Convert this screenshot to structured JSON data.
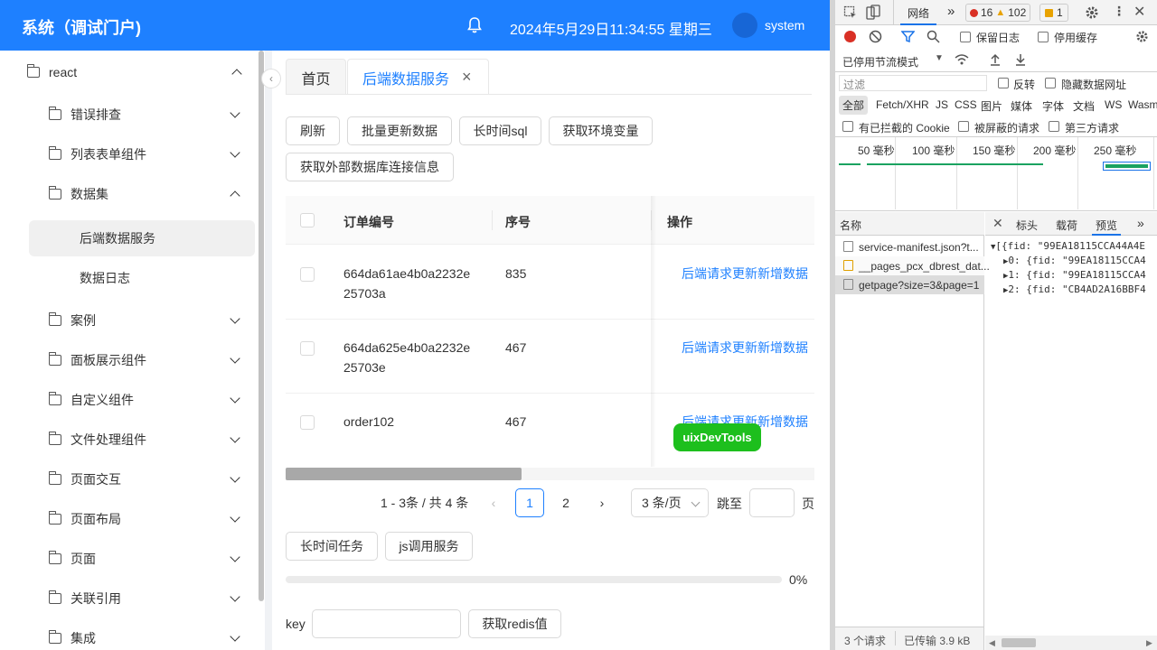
{
  "header": {
    "title": "系统（调试门户)",
    "datetime": "2024年5月29日11:34:55 星期三",
    "user": "system"
  },
  "sidebar": {
    "root": "react",
    "items": [
      {
        "label": "错误排查"
      },
      {
        "label": "列表表单组件"
      },
      {
        "label": "数据集"
      },
      {
        "label": "案例"
      },
      {
        "label": "面板展示组件"
      },
      {
        "label": "自定义组件"
      },
      {
        "label": "文件处理组件"
      },
      {
        "label": "页面交互"
      },
      {
        "label": "页面布局"
      },
      {
        "label": "页面"
      },
      {
        "label": "关联引用"
      },
      {
        "label": "集成"
      }
    ],
    "sub_items": [
      {
        "label": "后端数据服务"
      },
      {
        "label": "数据日志"
      }
    ]
  },
  "tabs": [
    {
      "label": "首页"
    },
    {
      "label": "后端数据服务",
      "close": "×"
    }
  ],
  "toolbar": {
    "refresh": "刷新",
    "batch_update": "批量更新数据",
    "long_sql": "长时间sql",
    "get_env": "获取环境变量",
    "get_external_db": "获取外部数据库连接信息"
  },
  "table": {
    "headers": [
      "订单编号",
      "序号",
      "操作"
    ],
    "rows": [
      {
        "order_line1": "664da61ae4b0a2232e",
        "order_line2": "25703a",
        "seq": "835",
        "action": "后端请求更新新增数据"
      },
      {
        "order_line1": "664da625e4b0a2232e",
        "order_line2": "25703e",
        "seq": "467",
        "action": "后端请求更新新增数据"
      },
      {
        "order_line1": "order102",
        "order_line2": "",
        "seq": "467",
        "action": "后端请求更新新增数据"
      }
    ]
  },
  "devtools_badge": "uixDevTools",
  "pagination": {
    "summary": "1 - 3条 / 共 4 条",
    "prev": "‹",
    "pages": [
      "1",
      "2"
    ],
    "next": "›",
    "page_size": "3 条/页",
    "jump_label": "跳至",
    "page_label": "页"
  },
  "actions": {
    "long_task": "长时间任务",
    "js_service": "js调用服务",
    "progress": 0,
    "progress_text": "0%",
    "key_label": "key",
    "get_redis": "获取redis值"
  },
  "devtools": {
    "network_tab": "网络",
    "more": "»",
    "errors": "16",
    "warnings": "102",
    "issues": "1",
    "preserve_log": "保留日志",
    "disable_cache": "停用缓存",
    "throttle": "已停用节流模式",
    "filter_placeholder": "过滤",
    "invert": "反转",
    "hide_data_urls": "隐藏数据网址",
    "types": [
      "全部",
      "Fetch/XHR",
      "JS",
      "CSS",
      "图片",
      "媒体",
      "字体",
      "文档",
      "WS",
      "Wasm"
    ],
    "blocked_cookies": "有已拦截的 Cookie",
    "blocked_requests": "被屏蔽的请求",
    "third_party": "第三方请求",
    "timeline_ticks": [
      "50 毫秒",
      "100 毫秒",
      "150 毫秒",
      "200 毫秒",
      "250 毫秒"
    ],
    "name_header": "名称",
    "detail_tabs": [
      "标头",
      "载荷",
      "预览"
    ],
    "requests": [
      "service-manifest.json?t...",
      "__pages_pcx_dbrest_dat...",
      "getpage?size=3&page=1"
    ],
    "preview": [
      "[{fid: \"99EA18115CCA44A4E",
      "0: {fid: \"99EA18115CCA4",
      "1: {fid: \"99EA18115CCA4",
      "2: {fid: \"CB4AD2A16BBF4"
    ],
    "status_requests": "3 个请求",
    "status_transferred": "已传输 3.9 kB"
  }
}
